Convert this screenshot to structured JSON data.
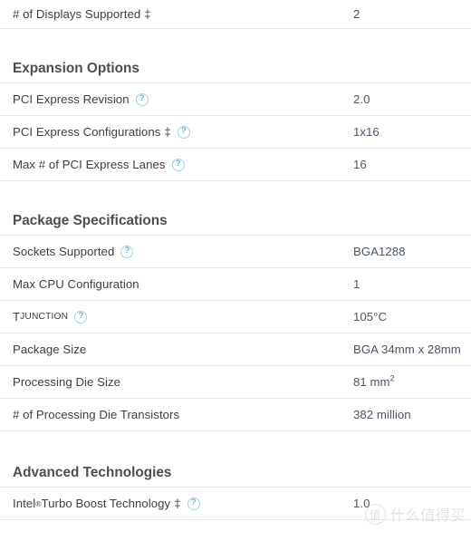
{
  "page": {
    "title": "Intel Product Specifications",
    "accent_help_icon_color": "#2b8fb5",
    "divider_color": "#e7e9ea",
    "label_color": "#3c4043",
    "value_color": "#4a5568",
    "heading_color": "#4a4f54"
  },
  "rows": {
    "displays_supported": {
      "label": "# of Displays Supported",
      "dagger": "‡",
      "value": "2"
    }
  },
  "sections": [
    {
      "heading": "Expansion Options",
      "rows": [
        {
          "label": "PCI Express Revision",
          "value": "2.0",
          "help": "?",
          "dagger": ""
        },
        {
          "label": "PCI Express Configurations",
          "value": "1x16",
          "help": "?",
          "dagger": "‡"
        },
        {
          "label": "Max # of PCI Express Lanes",
          "value": "16",
          "help": "?",
          "dagger": ""
        }
      ]
    },
    {
      "heading": "Package Specifications",
      "rows": [
        {
          "label": "Sockets Supported",
          "value": "BGA1288",
          "help": "?",
          "dagger": ""
        },
        {
          "label": "Max CPU Configuration",
          "value": "1",
          "help": "",
          "dagger": ""
        },
        {
          "label_prefix": "T",
          "label_small": "JUNCTION",
          "value": "105°C",
          "help": "?",
          "dagger": ""
        },
        {
          "label": "Package Size",
          "value": "BGA 34mm x 28mm",
          "help": "",
          "dagger": ""
        },
        {
          "label": "Processing Die Size",
          "value_prefix": "81 mm",
          "value_sup": "2",
          "help": "",
          "dagger": ""
        },
        {
          "label": "# of Processing Die Transistors",
          "value": "382 million",
          "help": "",
          "dagger": ""
        }
      ]
    },
    {
      "heading": "Advanced Technologies",
      "rows": [
        {
          "label_prefix": "Intel",
          "label_sup": "®",
          "label_suffix": " Turbo Boost Technology",
          "value": "1.0",
          "help": "?",
          "dagger": "‡"
        }
      ]
    }
  ],
  "watermark": {
    "mark": "值",
    "text": "什么值得买"
  }
}
